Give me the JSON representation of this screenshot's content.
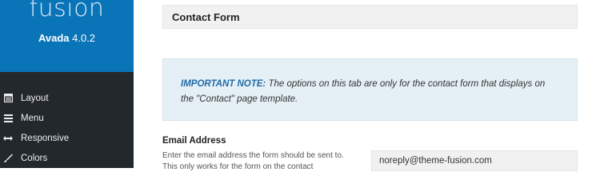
{
  "brand": {
    "logo_text": "fusion",
    "product_name": "Avada",
    "version": "4.0.2",
    "color": "#0a74b8"
  },
  "sidebar": {
    "background": "#23282d",
    "items": [
      {
        "label": "Layout",
        "icon": "layout-icon"
      },
      {
        "label": "Menu",
        "icon": "menu-icon"
      },
      {
        "label": "Responsive",
        "icon": "arrows-horizontal-icon"
      },
      {
        "label": "Colors",
        "icon": "brush-icon"
      }
    ]
  },
  "main": {
    "section_title": "Contact Form",
    "note": {
      "label": "IMPORTANT NOTE:",
      "text": " The options on this tab are only for the contact form that displays on the \"Contact\" page template."
    },
    "email_field": {
      "title": "Email Address",
      "description": "Enter the email address the form should be sent to. This only works for the form on the contact",
      "value": "noreply@theme-fusion.com"
    }
  }
}
